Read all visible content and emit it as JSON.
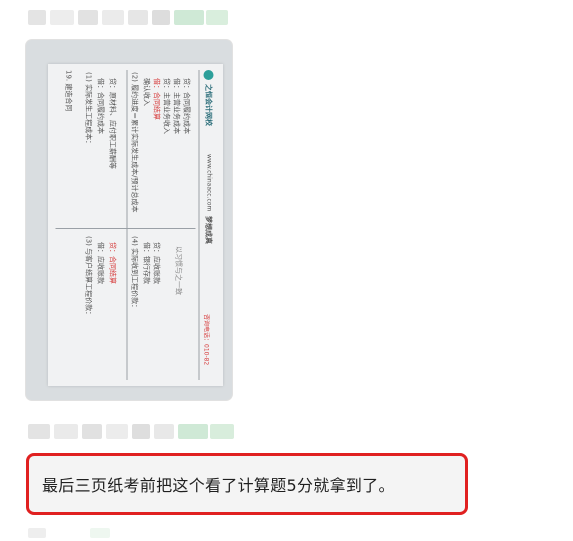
{
  "photo_message": {
    "document": {
      "heading": "19. 建造合同",
      "brand_name": "之恒会计网校",
      "brand_url": "www.chinaacc.com",
      "brand_tag": "梦想成真",
      "sections": [
        {
          "title": "(1) 实际发生工程成本：",
          "lines": [
            "借：合同履约成本",
            "贷：原材料、应付职工薪酬等"
          ]
        },
        {
          "title": "(2) 履约进度＝累计实际发生成本/预计总成本",
          "lines": [
            "确认收入",
            "借：合同结算",
            "贷：主营业务收入",
            "借：主营业务成本",
            "贷：合同履约成本"
          ],
          "emph": "合同结算"
        },
        {
          "title": "(3) 与客户结算工程价款：",
          "lines": [
            "借：应收账款",
            "贷：合同结算"
          ],
          "emph": "合同结算"
        },
        {
          "title": "(4) 实际收到工程价款：",
          "lines": [
            "借：银行存款",
            "贷：应收账款"
          ]
        }
      ],
      "footer_red": "咨询电话：010-82",
      "footer_gray": "以习惯与之一致"
    }
  },
  "text_message": {
    "content": "最后三页纸考前把这个看了计算题5分就拿到了。"
  },
  "colors": {
    "highlight_border": "#e02020",
    "bubble_bg": "#f4f4f4",
    "blur_green": "#cfe9d6",
    "blur_gray": "#e6e6e6"
  }
}
